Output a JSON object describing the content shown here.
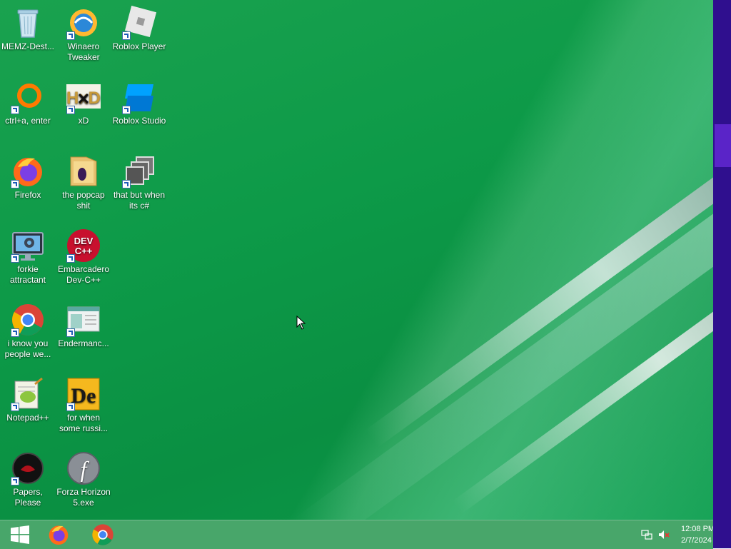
{
  "desktop": {
    "icons": [
      {
        "label": "MEMZ-Dest...",
        "icon": "recycle-bin-icon"
      },
      {
        "label": "Winaero Tweaker",
        "icon": "winaero-tweaker-icon"
      },
      {
        "label": "Roblox Player",
        "icon": "roblox-player-icon"
      },
      {
        "label": "ctrl+a, enter",
        "icon": "orange-ring-icon"
      },
      {
        "label": "xD",
        "icon": "hxd-icon"
      },
      {
        "label": "Roblox Studio",
        "icon": "roblox-studio-icon"
      },
      {
        "label": "Firefox",
        "icon": "firefox-icon"
      },
      {
        "label": "the popcap shit",
        "icon": "folder-icon"
      },
      {
        "label": "that but when its c#",
        "icon": "windows-stack-icon"
      },
      {
        "label": "forkie attractant",
        "icon": "monitor-gear-icon"
      },
      {
        "label": "Embarcadero Dev-C++",
        "icon": "dev-cpp-icon"
      },
      {
        "label": "i know you people we...",
        "icon": "chrome-icon"
      },
      {
        "label": "Endermanc...",
        "icon": "window-app-icon"
      },
      {
        "label": "Notepad++",
        "icon": "notepad-plus-plus-icon"
      },
      {
        "label": "for when some russi...",
        "icon": "de-icon"
      },
      {
        "label": "Papers, Please",
        "icon": "papers-please-icon"
      },
      {
        "label": "Forza Horizon 5.exe",
        "icon": "flash-icon"
      }
    ],
    "dev_icon_text": "DEV C++",
    "hxd_icon_text": "HxD",
    "de_icon_text": "De",
    "flash_icon_text": "f"
  },
  "taskbar": {
    "start": {
      "icon": "windows-logo-icon"
    },
    "pinned": [
      {
        "icon": "firefox-icon"
      },
      {
        "icon": "chrome-icon"
      }
    ],
    "tray": {
      "network_icon": "network-icon",
      "volume_icon": "volume-muted-icon",
      "time": "12:08 PM",
      "date": "2/7/2024"
    }
  },
  "colors": {
    "desktop_green": "#0d9a48",
    "side_strip": "#2f0f8e",
    "side_thumb": "#5a24c8"
  }
}
